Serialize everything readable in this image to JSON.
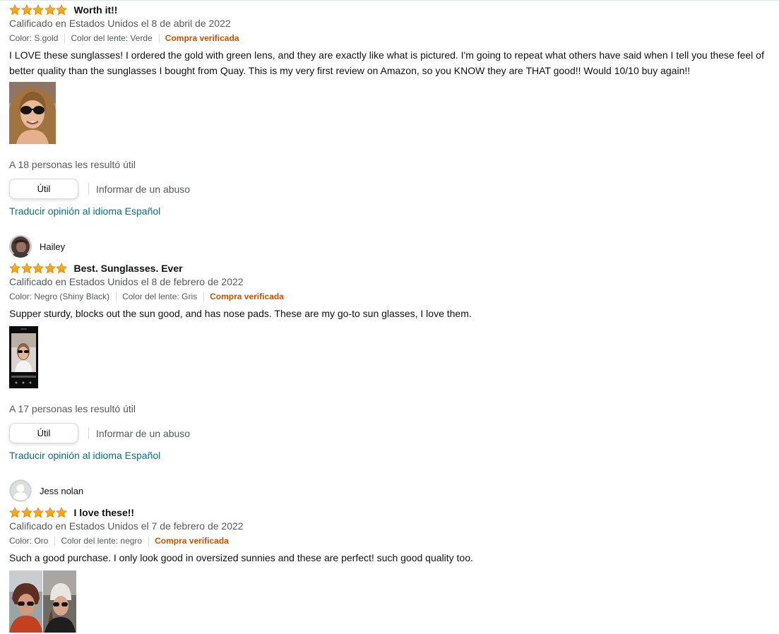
{
  "colors": {
    "star": "#ffa41c",
    "verified": "#c45500",
    "link": "#007185",
    "muted": "#565959"
  },
  "reviews": [
    {
      "rating": 5,
      "title": "Worth it!!",
      "date": "Calificado en Estados Unidos el 8 de abril de 2022",
      "variant_color": "Color: S.gold",
      "lens_color": "Color del lente: Verde",
      "verified": "Compra verificada",
      "body": "I LOVE these sunglasses! I ordered the gold with green lens, and they are exactly like what is pictured. I'm going to repeat what others have said when I tell you these feel of better quality than the sunglasses I bought from Quay. This is my very first review on Amazon, so you KNOW they are THAT good!! Would 10/10 buy again!!",
      "helpful": "A 18 personas les resultó útil",
      "helpful_button": "Útil",
      "report": "Informar de un abuso",
      "translate": "Traducir opinión al idioma Español"
    },
    {
      "reviewer": "Hailey",
      "avatar_icon": "user-photo-avatar",
      "rating": 5,
      "title": "Best. Sunglasses. Ever",
      "date": "Calificado en Estados Unidos el 8 de febrero de 2022",
      "variant_color": "Color: Negro (Shiny Black)",
      "lens_color": "Color del lente: Gris",
      "verified": "Compra verificada",
      "body": "Supper sturdy, blocks out the sun good, and has nose pads. These are my go-to sun glasses, I love them.",
      "helpful": "A 17 personas les resultó útil",
      "helpful_button": "Útil",
      "report": "Informar de un abuso",
      "translate": "Traducir opinión al idioma Español"
    },
    {
      "reviewer": "Jess nolan",
      "avatar_icon": "default-user-avatar-icon",
      "rating": 5,
      "title": "I love these!!",
      "date": "Calificado en Estados Unidos el 7 de febrero de 2022",
      "variant_color": "Color: Oro",
      "lens_color": "Color del lente: negro",
      "verified": "Compra verificada",
      "body": "Such a good purchase. I only look good in oversized sunnies and these are perfect! such good quality too."
    }
  ]
}
